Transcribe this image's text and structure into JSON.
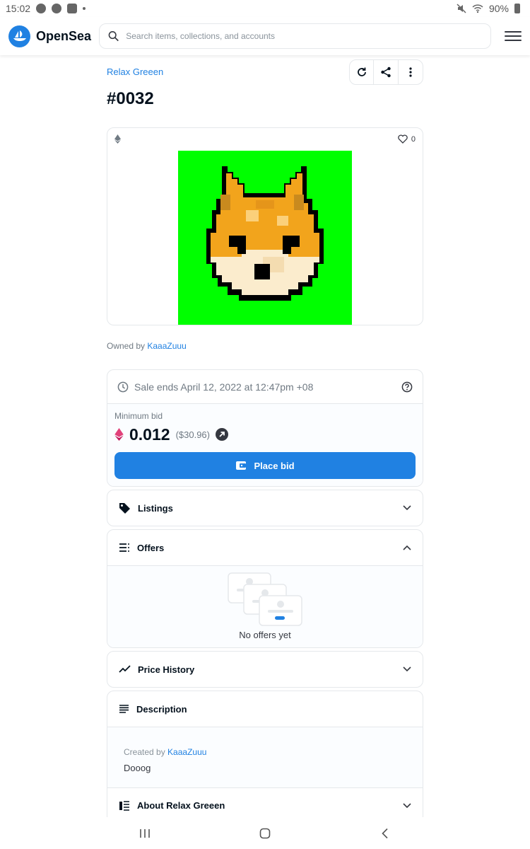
{
  "status_bar": {
    "time": "15:02",
    "battery": "90%"
  },
  "header": {
    "logo_text": "OpenSea",
    "search_placeholder": "Search items, collections, and accounts"
  },
  "item": {
    "collection": "Relax Greeen",
    "title": "#0032",
    "favorites": "0",
    "owned_prefix": "Owned by",
    "owner": "KaaaZuuu"
  },
  "sale": {
    "ends_text": "Sale ends April 12, 2022 at 12:47pm +08",
    "min_bid_label": "Minimum bid",
    "price": "0.012",
    "usd": "($30.96)",
    "place_bid_label": "Place bid"
  },
  "sections": {
    "listings": "Listings",
    "offers": "Offers",
    "no_offers": "No offers yet",
    "price_history": "Price History",
    "description": "Description",
    "created_prefix": "Created by",
    "creator": "KaaaZuuu",
    "description_text": "Dooog",
    "about": "About Relax Greeen"
  },
  "colors": {
    "accent": "#2081e2",
    "nft_background": "#00ff00"
  }
}
